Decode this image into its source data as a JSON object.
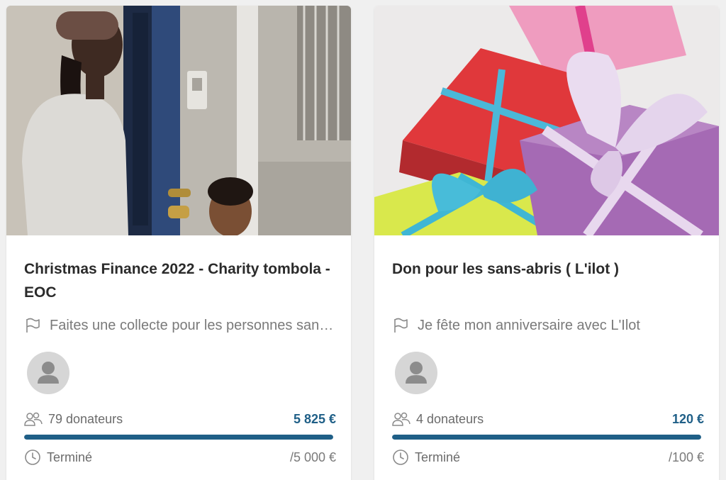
{
  "colors": {
    "accent": "#1f5f87",
    "track": "#dde6ec",
    "avatar_bg": "#d6d6d6"
  },
  "cards": [
    {
      "image": "photo-woman-and-child-at-doorway",
      "title": "Christmas Finance 2022 - Charity tombola - EOC",
      "subtitle_icon": "flag-icon",
      "subtitle": "Faites une collecte pour les personnes sans-abri",
      "avatar_icon": "user-icon",
      "donors_icon": "users-icon",
      "donors": "79 donateurs",
      "amount": "5 825 €",
      "progress": 1.0,
      "status_icon": "clock-icon",
      "status": "Terminé",
      "goal": "/5 000 €"
    },
    {
      "image": "photo-gift-boxes-with-ribbons",
      "title": "Don pour les sans-abris ( L'ilot )",
      "subtitle_icon": "flag-icon",
      "subtitle": "Je fête mon anniversaire avec L'Ilot",
      "avatar_icon": "user-icon",
      "donors_icon": "users-icon",
      "donors": "4 donateurs",
      "amount": "120 €",
      "progress": 1.0,
      "status_icon": "clock-icon",
      "status": "Terminé",
      "goal": "/100 €"
    }
  ]
}
